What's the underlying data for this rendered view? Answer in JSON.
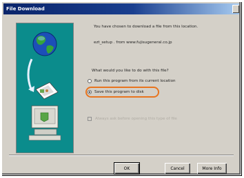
{
  "window": {
    "title": "File Download"
  },
  "message": {
    "line1": "You have chosen to download a file from this location.",
    "filename": "ezt_setup . from www.fujisugeneral.co.jp",
    "question": "What would you like to do with this file?"
  },
  "options": [
    {
      "label": "Run this program from its current location",
      "selected": false
    },
    {
      "label": "Save this program to disk",
      "selected": true
    }
  ],
  "checkbox": {
    "label": "Always ask before opening this type of file",
    "checked": true,
    "enabled": false
  },
  "buttons": {
    "ok": "OK",
    "cancel": "Cancel",
    "more_info": "More Info"
  },
  "colors": {
    "title_bar": "#0a246a",
    "dialog_bg": "#d4d0c8",
    "highlight": "#e8741e",
    "art_bg": "#0b8c8c"
  }
}
